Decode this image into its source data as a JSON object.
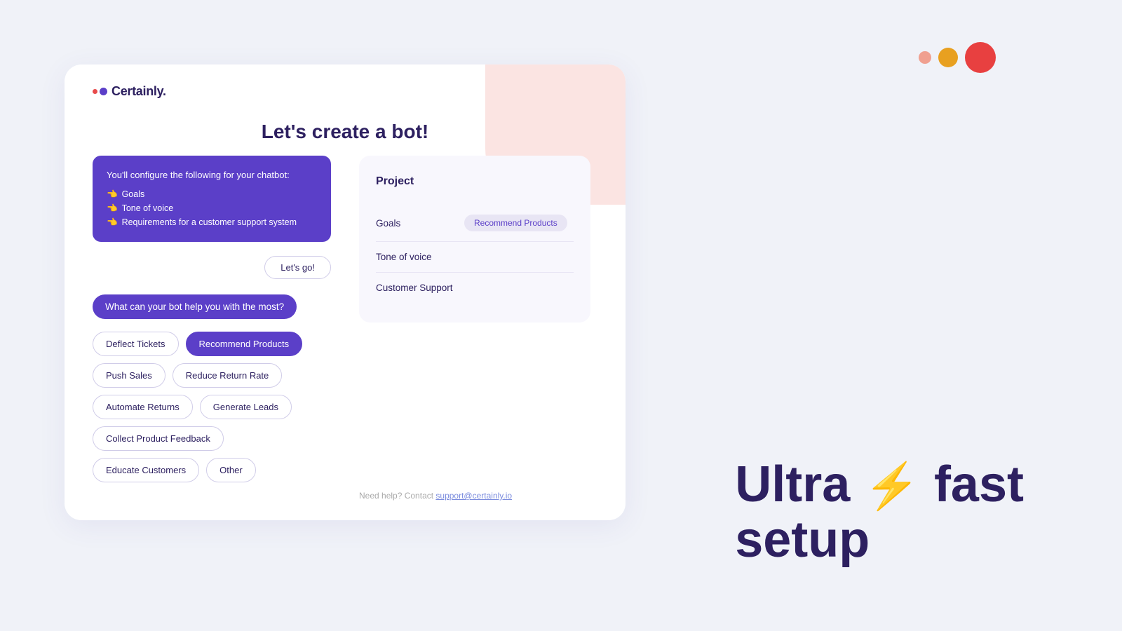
{
  "circles": {
    "colors": [
      "#f0a090",
      "#e8a020",
      "#e84040"
    ]
  },
  "logo": {
    "text": "Certainly."
  },
  "page": {
    "title": "Let's create a bot!"
  },
  "infoBox": {
    "intro": "You'll configure the following for your chatbot:",
    "items": [
      "Goals",
      "Tone of voice",
      "Requirements for a customer support system"
    ]
  },
  "letsGoBtn": "Let's go!",
  "question": "What can your bot help you with the most?",
  "options": [
    {
      "label": "Deflect Tickets",
      "selected": false
    },
    {
      "label": "Recommend Products",
      "selected": true
    },
    {
      "label": "Push Sales",
      "selected": false
    },
    {
      "label": "Reduce Return Rate",
      "selected": false
    },
    {
      "label": "Automate Returns",
      "selected": false
    },
    {
      "label": "Generate Leads",
      "selected": false
    },
    {
      "label": "Collect Product Feedback",
      "selected": false
    },
    {
      "label": "Educate Customers",
      "selected": false
    },
    {
      "label": "Other",
      "selected": false
    }
  ],
  "project": {
    "title": "Project",
    "rows": [
      {
        "label": "Goals",
        "value": "Recommend Products"
      },
      {
        "label": "Tone of voice",
        "value": ""
      },
      {
        "label": "Customer Support",
        "value": ""
      }
    ]
  },
  "helpText": {
    "prefix": "Need help? Contact ",
    "linkText": "support@certainly.io"
  },
  "tagline": {
    "pre": "Ultra ",
    "icon": "⚡",
    "post": " fast\nsetup"
  }
}
